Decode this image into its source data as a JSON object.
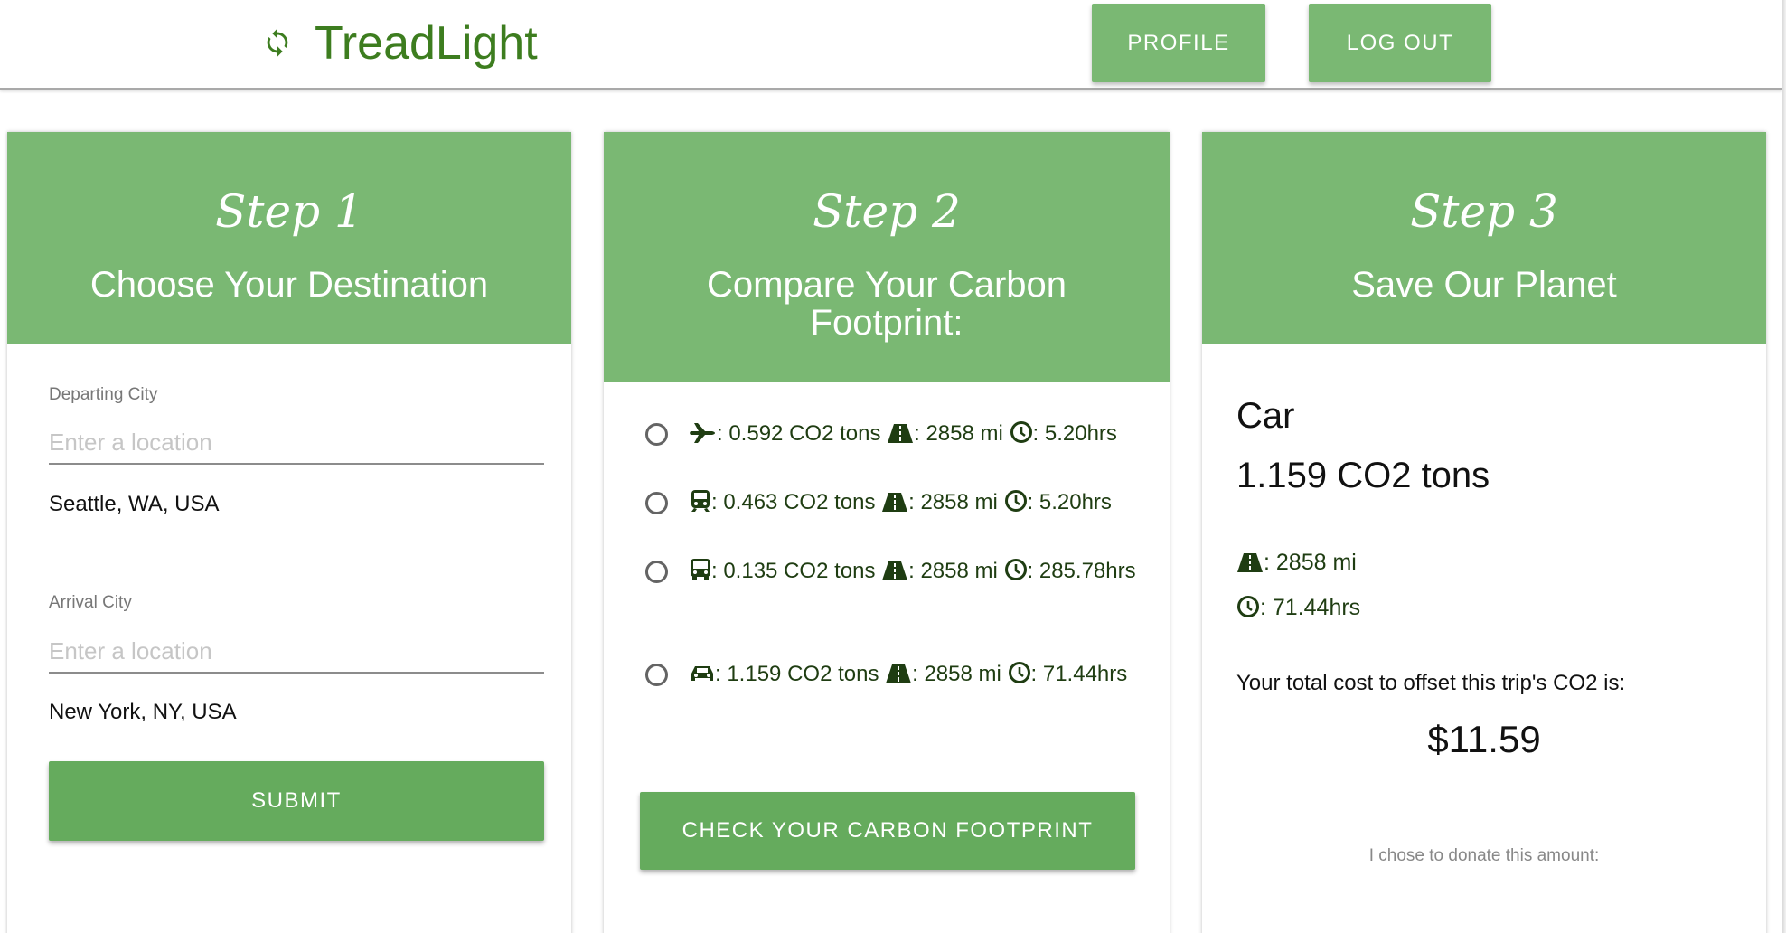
{
  "header": {
    "app_name": "TreadLight",
    "profile_label": "PROFILE",
    "logout_label": "LOG OUT"
  },
  "step1": {
    "step": "Step 1",
    "title": "Choose Your Destination",
    "departing_label": "Departing City",
    "departing_placeholder": "Enter a location",
    "departing_value": "Seattle, WA, USA",
    "arrival_label": "Arrival City",
    "arrival_placeholder": "Enter a location",
    "arrival_value": "New York, NY, USA",
    "submit_label": "SUBMIT"
  },
  "step2": {
    "step": "Step 2",
    "title": "Compare Your Carbon Footprint:",
    "options": [
      {
        "icon": "plane-icon",
        "co2": ": 0.592 CO2 tons",
        "distance": ": 2858 mi",
        "time": ": 5.20hrs"
      },
      {
        "icon": "train-icon",
        "co2": ": 0.463 CO2 tons",
        "distance": ": 2858 mi",
        "time": ": 5.20hrs"
      },
      {
        "icon": "bus-icon",
        "co2": ": 0.135 CO2 tons",
        "distance": ": 2858 mi",
        "time": ": 285.78hrs"
      },
      {
        "icon": "car-icon",
        "co2": ": 1.159 CO2 tons",
        "distance": ": 2858 mi",
        "time": ": 71.44hrs"
      }
    ],
    "check_label": "CHECK YOUR CARBON FOOTPRINT"
  },
  "step3": {
    "step": "Step 3",
    "title": "Save Our Planet",
    "mode": "Car",
    "co2": "1.159 CO2 tons",
    "distance": ": 2858 mi",
    "time": ": 71.44hrs",
    "cost_label": "Your total cost to offset this trip's CO2 is:",
    "cost": "$11.59",
    "donate_label": "I chose to donate this amount:"
  },
  "colors": {
    "brand_green": "#3d7d1f",
    "header_green": "#7ab873",
    "button_green": "#65ab5d",
    "icon_dark_green": "#1f3d12"
  }
}
